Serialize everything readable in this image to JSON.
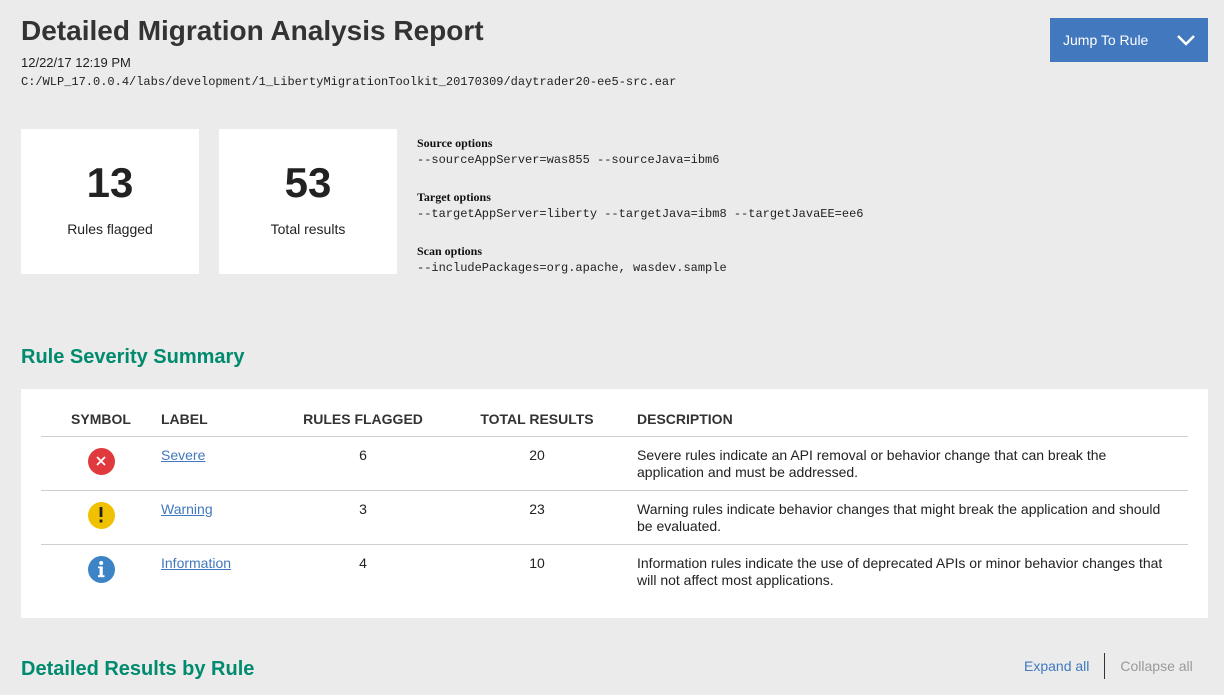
{
  "header": {
    "title": "Detailed Migration Analysis Report",
    "date": "12/22/17 12:19 PM",
    "path": "C:/WLP_17.0.0.4/labs/development/1_LibertyMigrationToolkit_20170309/daytrader20-ee5-src.ear",
    "jump_button_label": "Jump To Rule",
    "jump_icon": "chevron-down-icon"
  },
  "stats": {
    "rules_flagged": {
      "value": "13",
      "label": "Rules flagged"
    },
    "total_results": {
      "value": "53",
      "label": "Total results"
    }
  },
  "options": {
    "source": {
      "heading": "Source options",
      "value": "--sourceAppServer=was855 --sourceJava=ibm6"
    },
    "target": {
      "heading": "Target options",
      "value": "--targetAppServer=liberty --targetJava=ibm8 --targetJavaEE=ee6"
    },
    "scan": {
      "heading": "Scan options",
      "value": "--includePackages=org.apache, wasdev.sample"
    }
  },
  "severity_summary": {
    "title": "Rule Severity Summary",
    "columns": [
      "SYMBOL",
      "LABEL",
      "RULES FLAGGED",
      "TOTAL RESULTS",
      "DESCRIPTION"
    ],
    "rows": [
      {
        "icon": "severe-x-icon",
        "color": "#e0393e",
        "label": "Severe",
        "rules_flagged": "6",
        "total_results": "20",
        "description": "Severe rules indicate an API removal or behavior change that can break the application and must be addressed."
      },
      {
        "icon": "warning-exclamation-icon",
        "color": "#efc100",
        "label": "Warning",
        "rules_flagged": "3",
        "total_results": "23",
        "description": "Warning rules indicate behavior changes that might break the application and should be evaluated."
      },
      {
        "icon": "info-icon",
        "color": "#3d84c6",
        "label": "Information",
        "rules_flagged": "4",
        "total_results": "10",
        "description": "Information rules indicate the use of deprecated APIs or minor behavior changes that will not affect most applications."
      }
    ]
  },
  "detailed_results": {
    "title": "Detailed Results by Rule",
    "expand_all": "Expand all",
    "collapse_all": "Collapse all"
  },
  "colors": {
    "accent_blue": "#4178be",
    "section_green": "#008a6e",
    "background": "#ebebeb"
  }
}
